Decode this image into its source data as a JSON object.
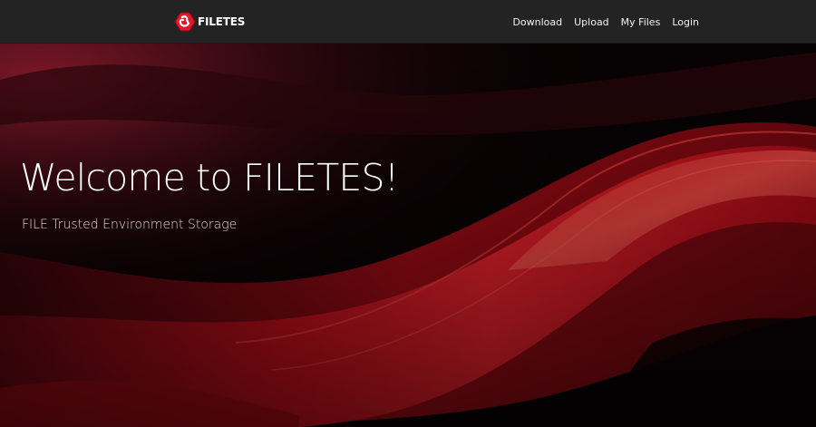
{
  "brand": {
    "name": "FILETES",
    "logo_icon": "red-hexagon-logo-icon",
    "accent_color": "#e0192c"
  },
  "nav": {
    "items": [
      {
        "label": "Download"
      },
      {
        "label": "Upload"
      },
      {
        "label": "My Files"
      },
      {
        "label": "Login"
      }
    ]
  },
  "hero": {
    "title": "Welcome to FILETES!",
    "subtitle": "FILE Trusted Environment Storage",
    "background": "red-silk-waves"
  },
  "colors": {
    "navbar": "#232323",
    "hero_dark": "#070203",
    "wave_red": "#d0101c"
  }
}
